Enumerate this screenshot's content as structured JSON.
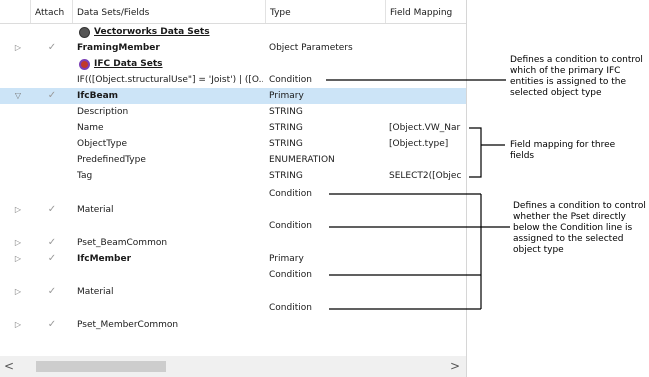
{
  "columns": {
    "attach": "Attach",
    "fields": "Data Sets/Fields",
    "type": "Type",
    "mapping": "Field Mapping"
  },
  "rows": [
    {
      "expander": "",
      "attach": "",
      "field": "Vectorworks Data Sets",
      "type": "",
      "mapping": ""
    },
    {
      "expander": "▷",
      "attach": "✓",
      "field": "FramingMember",
      "type": "Object Parameters",
      "mapping": ""
    },
    {
      "expander": "",
      "attach": "",
      "field": "IFC Data Sets",
      "type": "",
      "mapping": ""
    },
    {
      "expander": "",
      "attach": "",
      "field": "IF(([Object.structuralUse\"] = 'Joist') | ([O...",
      "type": "Condition",
      "mapping": ""
    },
    {
      "expander": "▽",
      "attach": "✓",
      "field": "IfcBeam",
      "type": "Primary",
      "mapping": ""
    },
    {
      "expander": "",
      "attach": "",
      "field": "Description",
      "type": "STRING",
      "mapping": ""
    },
    {
      "expander": "",
      "attach": "",
      "field": "Name",
      "type": "STRING",
      "mapping": "[Object.VW_Nar"
    },
    {
      "expander": "",
      "attach": "",
      "field": "ObjectType",
      "type": "STRING",
      "mapping": "[Object.type]"
    },
    {
      "expander": "",
      "attach": "",
      "field": "PredefinedType",
      "type": "ENUMERATION",
      "mapping": ""
    },
    {
      "expander": "",
      "attach": "",
      "field": "Tag",
      "type": "STRING",
      "mapping": "SELECT2([Objec"
    },
    {
      "expander": "",
      "attach": "",
      "field": "",
      "type": "Condition",
      "mapping": ""
    },
    {
      "expander": "▷",
      "attach": "✓",
      "field": "Material",
      "type": "",
      "mapping": ""
    },
    {
      "expander": "",
      "attach": "",
      "field": "",
      "type": "Condition",
      "mapping": ""
    },
    {
      "expander": "▷",
      "attach": "✓",
      "field": "Pset_BeamCommon",
      "type": "",
      "mapping": ""
    },
    {
      "expander": "▷",
      "attach": "✓",
      "field": "IfcMember",
      "type": "Primary",
      "mapping": ""
    },
    {
      "expander": "",
      "attach": "",
      "field": "",
      "type": "Condition",
      "mapping": ""
    },
    {
      "expander": "▷",
      "attach": "✓",
      "field": "Material",
      "type": "",
      "mapping": ""
    },
    {
      "expander": "",
      "attach": "",
      "field": "",
      "type": "Condition",
      "mapping": ""
    },
    {
      "expander": "▷",
      "attach": "✓",
      "field": "Pset_MemberCommon",
      "type": "",
      "mapping": ""
    }
  ],
  "scrollbar": {
    "left": "<",
    "right": ">"
  },
  "annotations": {
    "condition_primary": "Defines a condition to control which of the primary IFC entities is assigned to the selected object type",
    "field_mapping": "Field mapping for three fields",
    "condition_pset": "Defines a condition to control whether the Pset directly below the Condition line is assigned to the selected object type"
  },
  "colors": {
    "selected_row": "#cce4f7",
    "brand_icon": "#c0392b"
  }
}
